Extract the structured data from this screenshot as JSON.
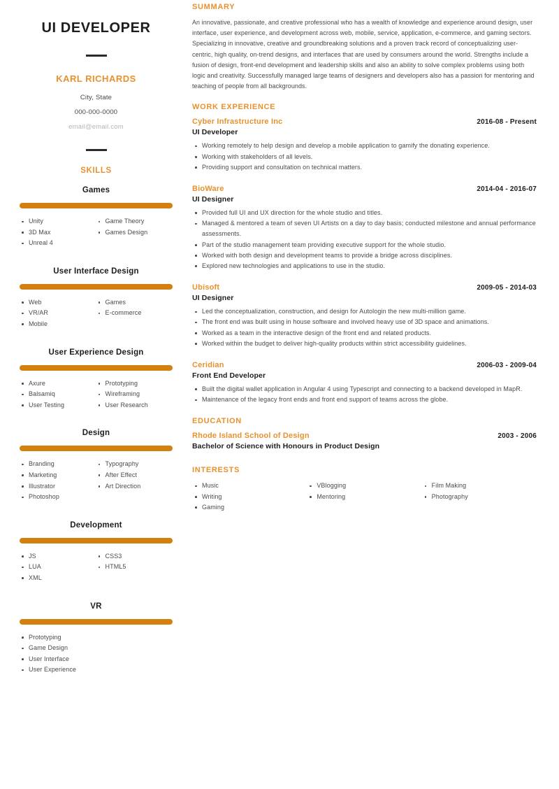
{
  "accent_color": "#E8912D",
  "bar_color": "#D4800E",
  "sidebar": {
    "job_title": "UI DEVELOPER",
    "name": "KARL RICHARDS",
    "location": "City, State",
    "phone": "000-000-0000",
    "email": "email@email.com",
    "skills_heading": "SKILLS",
    "skill_groups": [
      {
        "name": "Games",
        "col1": [
          "Unity",
          "3D Max",
          "Unreal 4"
        ],
        "col2": [
          "Game Theory",
          "Games Design"
        ]
      },
      {
        "name": "User Interface Design",
        "col1": [
          "Web",
          "VR/AR",
          "Mobile"
        ],
        "col2": [
          "Games",
          "E-commerce"
        ]
      },
      {
        "name": "User Experience Design",
        "col1": [
          "Axure",
          "Balsamiq",
          "User Testing"
        ],
        "col2": [
          "Prototyping",
          "Wireframing",
          "User Research"
        ]
      },
      {
        "name": "Design",
        "col1": [
          "Branding",
          "Marketing",
          "Illustrator",
          "Photoshop"
        ],
        "col2": [
          "Typography",
          "After Effect",
          "Art Direction"
        ]
      },
      {
        "name": "Development",
        "col1": [
          "JS",
          "LUA",
          "XML"
        ],
        "col2": [
          "CSS3",
          "HTML5"
        ]
      },
      {
        "name": "VR",
        "col1": [
          "Prototyping",
          "Game Design",
          "User Interface",
          "User Experience"
        ],
        "col2": []
      }
    ]
  },
  "main": {
    "summary": {
      "heading": "SUMMARY",
      "text": "An innovative, passionate, and creative professional who has a wealth of knowledge and experience around design, user interface, user experience, and development across web, mobile, service, application, e-commerce, and gaming sectors. Specializing in innovative, creative and groundbreaking solutions and a proven track record of conceptualizing user-centric, high quality, on-trend designs, and interfaces that are used by consumers around the world. Strengths include a fusion of design, front-end development and leadership skills and also an ability to solve complex problems using both logic and creativity. Successfully managed large teams of designers and developers also has a passion for mentoring and teaching of people from all backgrounds."
    },
    "work": {
      "heading": "WORK EXPERIENCE",
      "jobs": [
        {
          "org": "Cyber Infrastructure Inc",
          "dates": "2016-08 - Present",
          "role": "UI Developer",
          "bullets": [
            "Working remotely to help design and develop a mobile application to gamify the donating experience.",
            "Working with stakeholders of all levels.",
            "Providing support and consultation on technical matters."
          ]
        },
        {
          "org": "BioWare",
          "dates": "2014-04 - 2016-07",
          "role": "UI Designer",
          "bullets": [
            "Provided full UI and UX direction for the whole studio and titles.",
            "Managed &  mentored a team of seven UI Artists on a day to day basis; conducted milestone and annual performance assessments.",
            "Part of the studio management team providing executive support for the whole studio.",
            "Worked with both design and development teams to provide a bridge across disciplines.",
            "Explored new technologies and applications to use in the studio."
          ]
        },
        {
          "org": "Ubisoft",
          "dates": "2009-05 - 2014-03",
          "role": "UI Designer",
          "bullets": [
            "Led the conceptualization, construction, and design for Autologin the new multi-million game.",
            "The front end was built using in house software and involved heavy use of 3D space and animations.",
            "Worked as a team in the interactive design of the front end and related products.",
            "Worked within the budget to deliver high-quality products within strict accessibility guidelines."
          ]
        },
        {
          "org": "Ceridian",
          "dates": "2006-03 - 2009-04",
          "role": "Front End Developer",
          "bullets": [
            "Built the digital wallet application in Angular 4 using Typescript and connecting to a backend developed in MapR.",
            "Maintenance of the legacy front ends and front end support of teams across the globe."
          ]
        }
      ]
    },
    "education": {
      "heading": "EDUCATION",
      "school": "Rhode Island School of Design",
      "dates": "2003 - 2006",
      "degree": "Bachelor of Science with Honours in Product Design"
    },
    "interests": {
      "heading": "INTERESTS",
      "col1": [
        "Music",
        "Writing",
        "Gaming"
      ],
      "col2": [
        "VBlogging",
        "Mentoring"
      ],
      "col3": [
        "Film Making",
        "Photography"
      ]
    }
  }
}
